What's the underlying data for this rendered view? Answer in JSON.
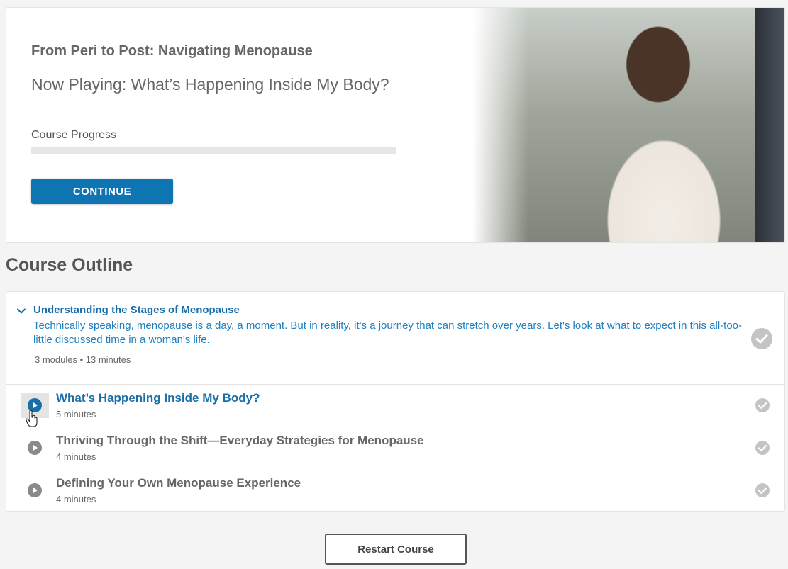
{
  "hero": {
    "course_title": "From Peri to Post: Navigating Menopause",
    "now_playing": "Now Playing: What’s Happening Inside My Body?",
    "progress_label": "Course Progress",
    "progress_fraction": 0,
    "continue_label": "CONTINUE"
  },
  "outline": {
    "heading": "Course Outline",
    "section": {
      "title": "Understanding the Stages of Menopause",
      "description": "Technically speaking, menopause is a day, a moment. But in reality, it's a journey that can stretch over years. Let's look at what to expect in this all-too-little discussed time in a woman's life.",
      "meta": "3 modules • 13 minutes"
    },
    "modules": [
      {
        "title": "What’s Happening Inside My Body?",
        "duration": "5 minutes"
      },
      {
        "title": "Thriving Through the Shift—Everyday Strategies for Menopause",
        "duration": "4 minutes"
      },
      {
        "title": "Defining Your Own Menopause Experience",
        "duration": "4 minutes"
      }
    ]
  },
  "restart_label": "Restart Course",
  "colors": {
    "accent": "#0f74b2",
    "link": "#1a6ea8",
    "check_gray": "#c4c4c4",
    "play_gray": "#8a8a8a"
  },
  "icons": [
    "chevron-down-icon",
    "check-circle-icon",
    "play-circle-icon",
    "hand-cursor-icon"
  ]
}
